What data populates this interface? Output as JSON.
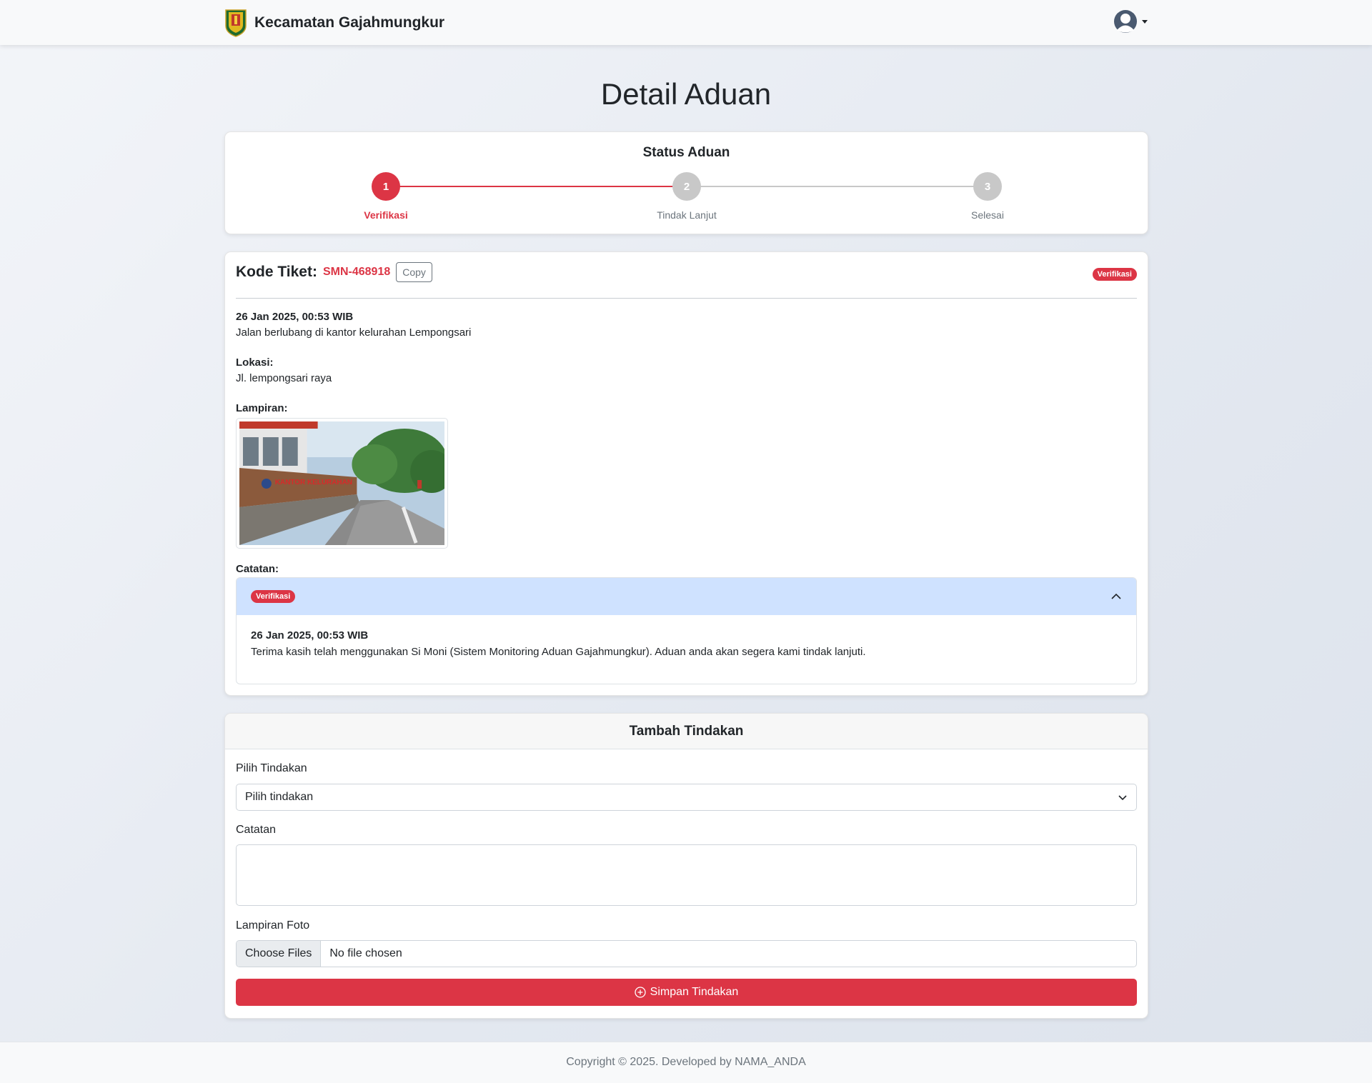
{
  "navbar": {
    "brand": "Kecamatan Gajahmungkur"
  },
  "page": {
    "title": "Detail Aduan"
  },
  "status": {
    "title": "Status Aduan",
    "steps": [
      {
        "number": "1",
        "label": "Verifikasi",
        "active": true
      },
      {
        "number": "2",
        "label": "Tindak Lanjut",
        "active": false
      },
      {
        "number": "3",
        "label": "Selesai",
        "active": false
      }
    ]
  },
  "ticket": {
    "label": "Kode Tiket:",
    "code": "SMN-468918",
    "copy_label": "Copy",
    "badge": "Verifikasi",
    "datetime": "26 Jan 2025, 00:53 WIB",
    "description": "Jalan berlubang di kantor kelurahan Lempongsari",
    "location_label": "Lokasi:",
    "location": "Jl. lempongsari raya",
    "attachment_label": "Lampiran:",
    "notes_label": "Catatan:",
    "note": {
      "badge": "Verifikasi",
      "datetime": "26 Jan 2025, 00:53 WIB",
      "text": "Terima kasih telah menggunakan Si Moni (Sistem Monitoring Aduan Gajahmungkur). Aduan anda akan segera kami tindak lanjuti."
    }
  },
  "form": {
    "title": "Tambah Tindakan",
    "action_label": "Pilih Tindakan",
    "action_selected": "Pilih tindakan",
    "notes_label": "Catatan",
    "notes_value": "",
    "photo_label": "Lampiran Foto",
    "file_button": "Choose Files",
    "file_status": "No file chosen",
    "submit_label": "Simpan Tindakan"
  },
  "footer": {
    "text": "Copyright © 2025. Developed by NAMA_ANDA"
  },
  "colors": {
    "accent": "#dc3545",
    "inactive_step": "#c8c8c8",
    "accordion_header": "#cfe2ff"
  }
}
